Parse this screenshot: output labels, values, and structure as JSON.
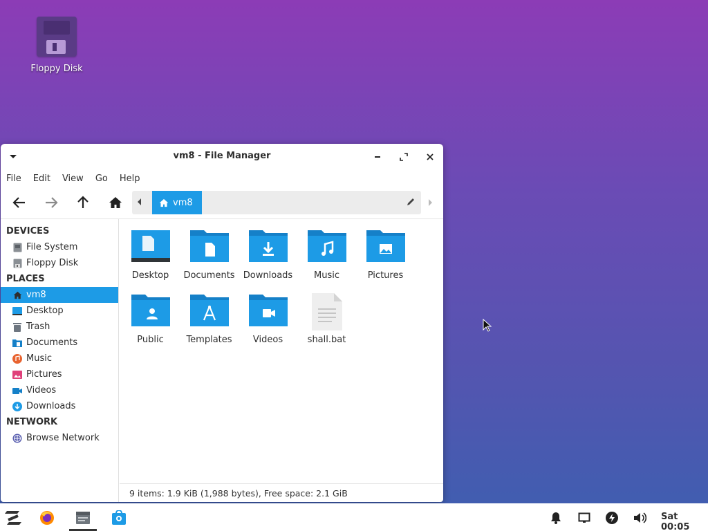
{
  "desktop": {
    "icons": [
      {
        "label": "Floppy Disk",
        "icon": "floppy-disk-icon"
      }
    ]
  },
  "window": {
    "title": "vm8 - File Manager",
    "menu": [
      "File",
      "Edit",
      "View",
      "Go",
      "Help"
    ],
    "path": {
      "crumb": "vm8"
    },
    "sidebar": {
      "devices_heading": "DEVICES",
      "devices": [
        {
          "label": "File System",
          "icon": "drive-icon"
        },
        {
          "label": "Floppy Disk",
          "icon": "floppy-icon"
        }
      ],
      "places_heading": "PLACES",
      "places": [
        {
          "label": "vm8",
          "icon": "home-icon",
          "selected": true
        },
        {
          "label": "Desktop",
          "icon": "desktop-icon"
        },
        {
          "label": "Trash",
          "icon": "trash-icon"
        },
        {
          "label": "Documents",
          "icon": "documents-icon"
        },
        {
          "label": "Music",
          "icon": "music-icon"
        },
        {
          "label": "Pictures",
          "icon": "pictures-icon"
        },
        {
          "label": "Videos",
          "icon": "videos-icon"
        },
        {
          "label": "Downloads",
          "icon": "downloads-icon"
        }
      ],
      "network_heading": "NETWORK",
      "network": [
        {
          "label": "Browse Network",
          "icon": "network-icon"
        }
      ]
    },
    "files": [
      {
        "name": "Desktop",
        "icon": "desktop-folder-icon"
      },
      {
        "name": "Documents",
        "icon": "documents-folder-icon"
      },
      {
        "name": "Downloads",
        "icon": "downloads-folder-icon"
      },
      {
        "name": "Music",
        "icon": "music-folder-icon"
      },
      {
        "name": "Pictures",
        "icon": "pictures-folder-icon"
      },
      {
        "name": "Public",
        "icon": "public-folder-icon"
      },
      {
        "name": "Templates",
        "icon": "templates-folder-icon"
      },
      {
        "name": "Videos",
        "icon": "videos-folder-icon"
      },
      {
        "name": "shall.bat",
        "icon": "text-file-icon"
      }
    ],
    "status": "9 items: 1.9 KiB (1,988 bytes), Free space: 2.1 GiB"
  },
  "taskbar": {
    "clock": "Sat 00:05",
    "launchers": [
      "zorin-menu-icon",
      "firefox-icon",
      "files-icon",
      "software-store-icon"
    ],
    "tray": [
      "notifications-icon",
      "display-icon",
      "power-icon",
      "volume-icon"
    ]
  },
  "colors": {
    "accent": "#1d9be6",
    "folder": "#1d9be6",
    "folder_tab": "#1580c8"
  }
}
